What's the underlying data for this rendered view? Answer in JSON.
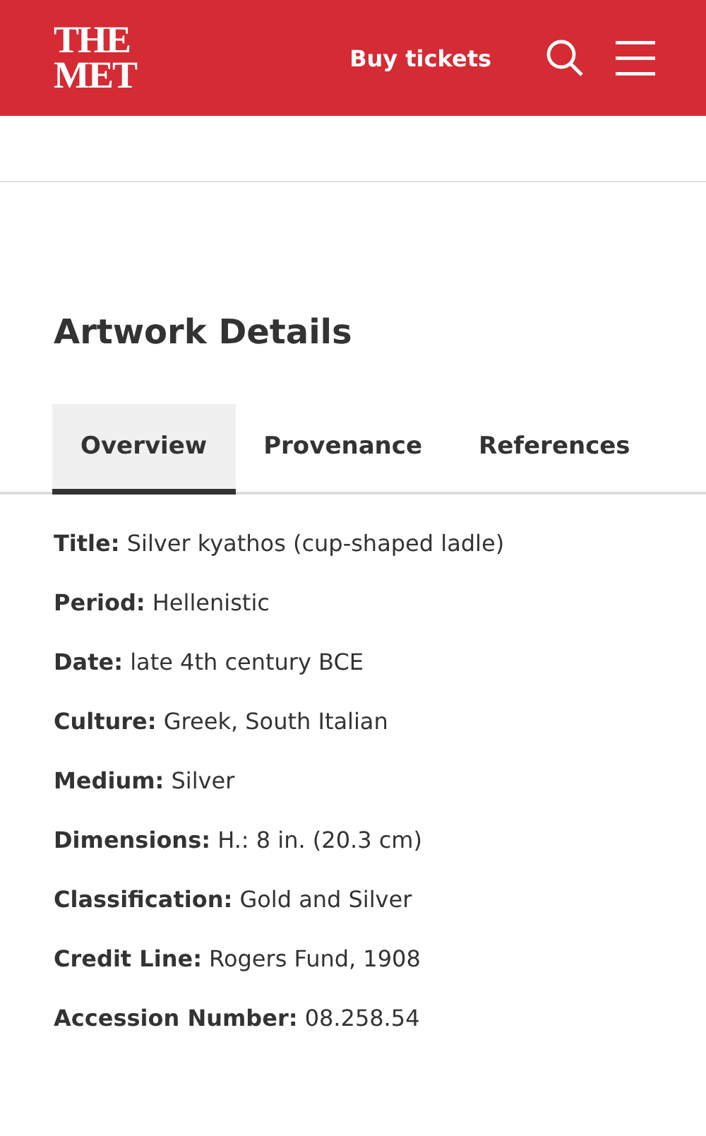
{
  "header": {
    "logo": [
      "THE",
      "MET"
    ],
    "buy_tickets": "Buy tickets"
  },
  "section_title": "Artwork Details",
  "tabs": [
    {
      "label": "Overview",
      "selected": true
    },
    {
      "label": "Provenance",
      "selected": false
    },
    {
      "label": "References",
      "selected": false
    }
  ],
  "details": [
    {
      "label": "Title:",
      "value": "Silver kyathos (cup-shaped ladle)"
    },
    {
      "label": "Period:",
      "value": "Hellenistic"
    },
    {
      "label": "Date:",
      "value": "late 4th century BCE"
    },
    {
      "label": "Culture:",
      "value": "Greek, South Italian"
    },
    {
      "label": "Medium:",
      "value": "Silver"
    },
    {
      "label": "Dimensions:",
      "value": "H.: 8 in. (20.3 cm)"
    },
    {
      "label": "Classification:",
      "value": "Gold and Silver"
    },
    {
      "label": "Credit Line:",
      "value": "Rogers Fund, 1908"
    },
    {
      "label": "Accession Number:",
      "value": "08.258.54"
    }
  ]
}
